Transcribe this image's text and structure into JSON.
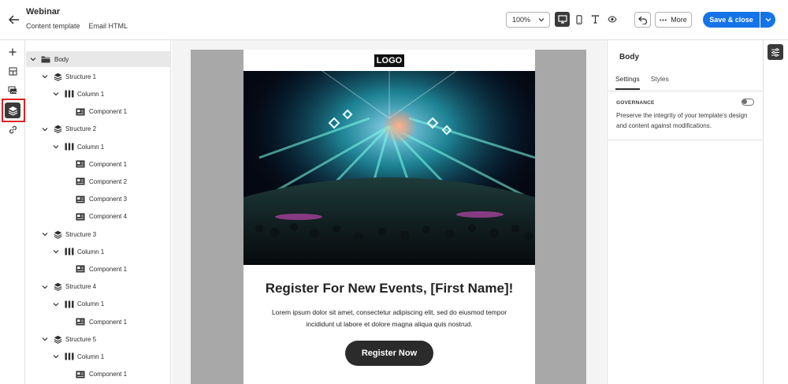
{
  "header": {
    "title": "Webinar",
    "breadcrumbs": [
      "Content template",
      "Email HTML"
    ],
    "zoom": "100%",
    "more_label": "More",
    "save_label": "Save & close"
  },
  "tree": {
    "items": [
      {
        "level": 0,
        "type": "folder",
        "label": "Body",
        "expanded": true,
        "selected": true
      },
      {
        "level": 1,
        "type": "structure",
        "label": "Structure 1",
        "expanded": true
      },
      {
        "level": 2,
        "type": "column",
        "label": "Column 1",
        "expanded": true
      },
      {
        "level": 3,
        "type": "component",
        "label": "Component 1"
      },
      {
        "level": 1,
        "type": "structure",
        "label": "Structure 2",
        "expanded": true
      },
      {
        "level": 2,
        "type": "column",
        "label": "Column 1",
        "expanded": true
      },
      {
        "level": 3,
        "type": "component",
        "label": "Component 1"
      },
      {
        "level": 3,
        "type": "component",
        "label": "Component 2"
      },
      {
        "level": 3,
        "type": "component",
        "label": "Component 3"
      },
      {
        "level": 3,
        "type": "component",
        "label": "Component 4"
      },
      {
        "level": 1,
        "type": "structure",
        "label": "Structure 3",
        "expanded": true
      },
      {
        "level": 2,
        "type": "column",
        "label": "Column 1",
        "expanded": true
      },
      {
        "level": 3,
        "type": "component",
        "label": "Component 1"
      },
      {
        "level": 1,
        "type": "structure",
        "label": "Structure 4",
        "expanded": true
      },
      {
        "level": 2,
        "type": "column",
        "label": "Column 1",
        "expanded": true
      },
      {
        "level": 3,
        "type": "component",
        "label": "Component 1"
      },
      {
        "level": 1,
        "type": "structure",
        "label": "Structure 5",
        "expanded": true
      },
      {
        "level": 2,
        "type": "column",
        "label": "Column 1",
        "expanded": true
      },
      {
        "level": 3,
        "type": "component",
        "label": "Component 1"
      }
    ]
  },
  "email": {
    "logo": "LOGO",
    "headline": "Register For New Events, [First Name]!",
    "body": "Lorem ipsum dolor sit amet, consectetur adipiscing elit, sed do eiusmod tempor incididunt ut labore et dolore magna aliqua quis nostrud.",
    "cta": "Register Now"
  },
  "properties": {
    "title": "Body",
    "tabs": [
      "Settings",
      "Styles"
    ],
    "active_tab": "Settings",
    "governance_label": "GOVERNANCE",
    "governance_desc": "Preserve the integrity of your template's design and content against modifications.",
    "governance_enabled": false
  },
  "colors": {
    "accent": "#1473e6",
    "highlight": "#e02020",
    "dark": "#2b2b2b"
  }
}
